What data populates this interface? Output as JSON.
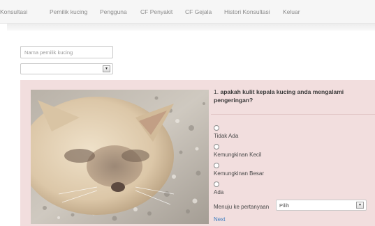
{
  "nav": {
    "items": [
      "Konsultasi",
      "Pemilik kucing",
      "Pengguna",
      "CF Penyakit",
      "CF Gejala",
      "Histori Konsultasi",
      "Keluar"
    ]
  },
  "form": {
    "owner_placeholder": "Nama pemilik kucing",
    "owner_select_value": ""
  },
  "question": {
    "number": "1.",
    "text": "apakah kulit kepala kucing anda mengalami pengeringan?",
    "options": [
      "Tidak Ada",
      "Kemungkinan Kecil",
      "Kemungkinan Besar",
      "Ada"
    ],
    "goto_label": "Menuju ke pertanyaan",
    "goto_value": "Pilih",
    "next_label": "Next"
  },
  "icons": {
    "select_arrow": "chevron-down-icon"
  },
  "colors": {
    "panel_bg": "#f2dede",
    "link": "#3b7bbf",
    "nav_bg": "#f6f6f6"
  }
}
